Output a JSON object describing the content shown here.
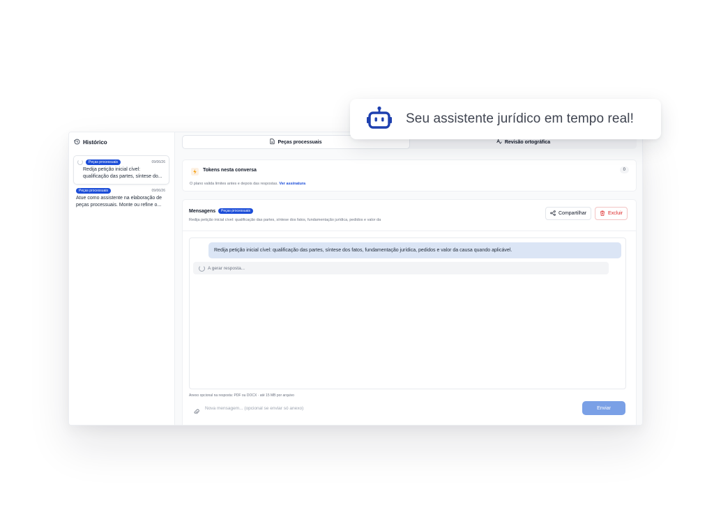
{
  "banner": {
    "icon": "robot-icon",
    "text": "Seu assistente jurídico em tempo real!"
  },
  "sidebar": {
    "title": "Histórico",
    "items": [
      {
        "badge": "Peças processuais",
        "date": "09/06/26",
        "text_line1": "Redija petição inicial cível:",
        "text_line2": "qualificação das partes, síntese do..."
      },
      {
        "badge": "Peças processuais",
        "date": "09/06/26",
        "text_line1": "Atue como assistente na elaboração de",
        "text_line2": "peças processuais. Monte ou refine o..."
      }
    ]
  },
  "tabs": [
    {
      "label": "Peças processuais",
      "icon": "document-icon",
      "active": true
    },
    {
      "label": "Revisão ortográfica",
      "icon": "spellcheck-icon",
      "active": false
    }
  ],
  "tokens": {
    "title": "Tokens nesta conversa",
    "count": "0",
    "note": "O plano valida limites antes e depois das respostas.",
    "link": "Ver assinatura"
  },
  "messages": {
    "title": "Mensagens",
    "badge": "Peças processuais",
    "subtitle": "Redija petição inicial cível: qualificação das partes, síntese dos fatos, fundamentação jurídica, pedidos e valor da",
    "share_label": "Compartilhar",
    "delete_label": "Excluir",
    "user_message": "Redija petição inicial cível: qualificação das partes, síntese dos fatos, fundamentação jurídica, pedidos e valor da causa quando aplicável.",
    "loading_text": "A gerar resposta...",
    "attach_note": "Anexo opcional na resposta: PDF ou DOCX · até 15 MB por arquivo",
    "input_placeholder": "Nova mensagem... (opcional se enviar só anexo)",
    "send_label": "Enviar"
  },
  "colors": {
    "accent": "#1d4ed8",
    "send": "#7aa0e6",
    "danger": "#dc2626",
    "bubble": "#dbe5f5"
  }
}
